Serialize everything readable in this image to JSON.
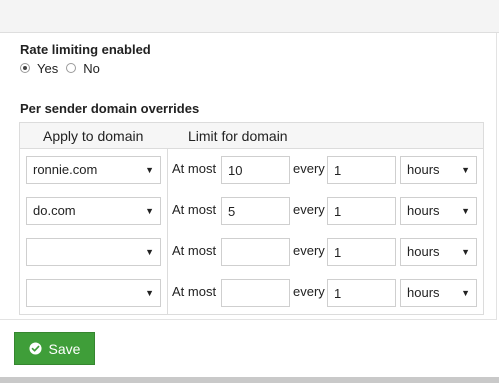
{
  "rate_limiting": {
    "label": "Rate limiting enabled",
    "options": [
      {
        "label": "Yes",
        "checked": true
      },
      {
        "label": "No",
        "checked": false
      }
    ]
  },
  "overrides": {
    "label": "Per sender domain overrides",
    "headers": [
      "Apply to domain",
      "Limit for domain"
    ],
    "at_most_label": "At most",
    "every_label": "every",
    "rows": [
      {
        "domain": "ronnie.com",
        "limit": "10",
        "every": "1",
        "unit": "hours"
      },
      {
        "domain": "do.com",
        "limit": "5",
        "every": "1",
        "unit": "hours"
      },
      {
        "domain": "",
        "limit": "",
        "every": "1",
        "unit": "hours"
      },
      {
        "domain": "",
        "limit": "",
        "every": "1",
        "unit": "hours"
      }
    ]
  },
  "save_button": {
    "label": "Save",
    "icon": "check-circle-icon",
    "color": "#3f9e39"
  }
}
